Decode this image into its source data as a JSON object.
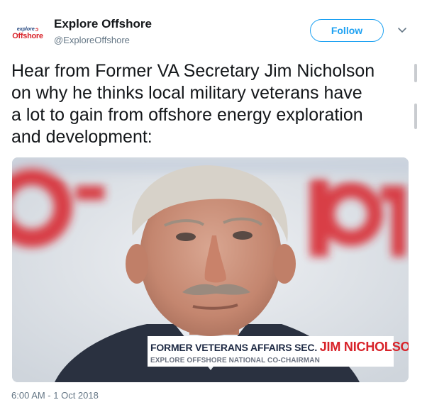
{
  "author": {
    "name": "Explore Offshore",
    "handle": "@ExploreOffshore",
    "avatar_logo_top": "explore",
    "avatar_logo_bottom": "Offshore"
  },
  "follow_button": {
    "label": "Follow"
  },
  "tweet": {
    "text_lines": [
      "Hear from Former VA Secretary Jim Nicholson",
      "on why he thinks local military veterans have",
      "a lot to gain from offshore energy exploration",
      "and development:"
    ],
    "timestamp": "6:00 AM - 1 Oct 2018"
  },
  "media": {
    "caption_prefix": "FORMER VETERANS AFFAIRS SEC.",
    "caption_name": "JIM NICHOLSON",
    "caption_subtitle": "EXPLORE OFFSHORE NATIONAL CO-CHAIRMAN",
    "background_lettering": "Offshore"
  },
  "icons": {
    "caret": "chevron-down-icon"
  },
  "colors": {
    "accent": "#1da1f2",
    "brand_red": "#d8232a",
    "brand_navy": "#1b3f7a",
    "secondary_text": "#657786"
  }
}
